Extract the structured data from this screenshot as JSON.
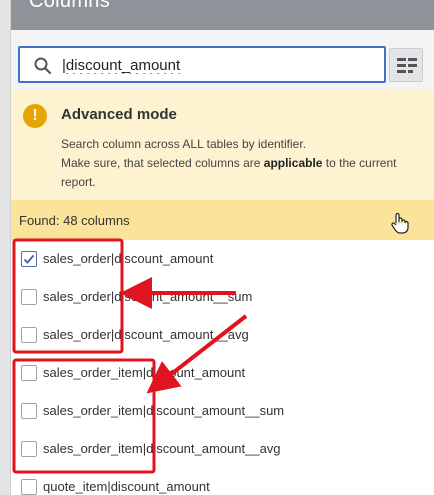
{
  "modal": {
    "title": "Columns"
  },
  "search": {
    "value": "|discount_amount",
    "icon": "search-icon"
  },
  "advanced_mode": {
    "title": "Advanced mode",
    "line1": "Search column across ALL tables by identifier.",
    "line2_before": "Make sure, that selected columns are ",
    "line2_bold": "applicable",
    "line2_after": " to the current",
    "line3": "report."
  },
  "found": {
    "label": "Found: 48 columns"
  },
  "columns": [
    {
      "label": "sales_order|discount_amount",
      "checked": true
    },
    {
      "label": "sales_order|discount_amount__sum",
      "checked": false
    },
    {
      "label": "sales_order|discount_amount__avg",
      "checked": false
    },
    {
      "label": "sales_order_item|discount_amount",
      "checked": false
    },
    {
      "label": "sales_order_item|discount_amount__sum",
      "checked": false
    },
    {
      "label": "sales_order_item|discount_amount__avg",
      "checked": false
    },
    {
      "label": "quote_item|discount_amount",
      "checked": false
    }
  ],
  "colors": {
    "accent": "#3f72c8",
    "annotation": "#e0141e",
    "warning": "#e6a400",
    "found_bar": "#fbe49a",
    "advanced_bg": "#fdf3d1"
  }
}
